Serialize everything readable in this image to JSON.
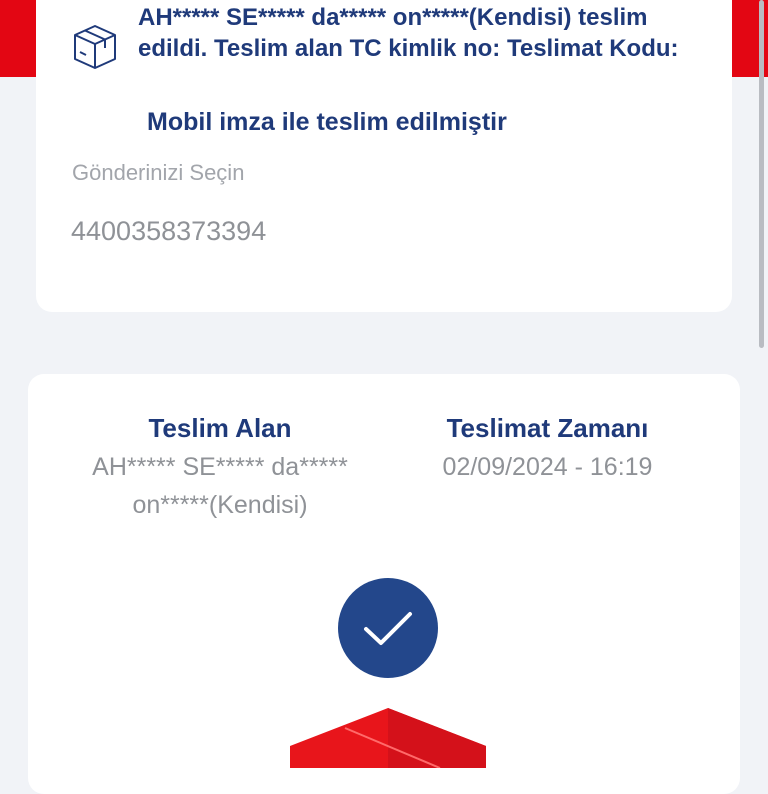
{
  "delivery_status": {
    "message": "AH***** SE***** da***** on*****(Kendisi) teslim edildi. Teslim alan TC kimlik no: Teslimat Kodu:",
    "mobile_sign_text": "Mobil imza ile teslim edilmiştir",
    "icon": "package-icon"
  },
  "shipment_select": {
    "label": "Gönderinizi Seçin",
    "tracking_number": "4400358373394"
  },
  "delivery_info": {
    "recipient_title": "Teslim Alan",
    "recipient_value": "AH***** SE***** da***** on*****(Kendisi)",
    "time_title": "Teslimat Zamanı",
    "time_value": "02/09/2024 - 16:19",
    "status_icon": "checkmark-icon",
    "parcel_icon": "parcel-icon"
  },
  "colors": {
    "brand_red": "#e30613",
    "brand_navy": "#1f3a7a",
    "check_blue": "#23478b",
    "background": "#f1f3f7"
  }
}
